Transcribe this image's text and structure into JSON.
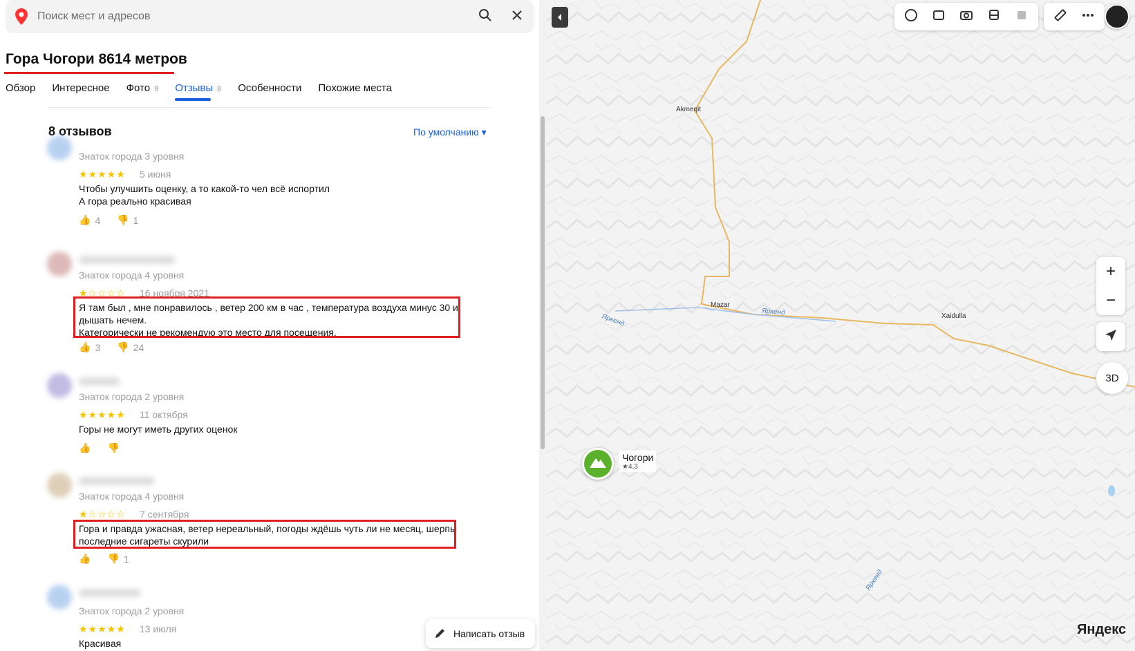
{
  "search": {
    "placeholder": "Поиск мест и адресов"
  },
  "place": {
    "title": "Гора Чогори 8614 метров"
  },
  "tabs": [
    {
      "label": "Обзор",
      "count": ""
    },
    {
      "label": "Интересное",
      "count": ""
    },
    {
      "label": "Фото",
      "count": "9"
    },
    {
      "label": "Отзывы",
      "count": "8"
    },
    {
      "label": "Особенности",
      "count": ""
    },
    {
      "label": "Похожие места",
      "count": ""
    }
  ],
  "reviews_header": {
    "title": "8 отзывов",
    "sort_label": "По умолчанию ▾"
  },
  "reviews": [
    {
      "level": "Знаток города 3 уровня",
      "stars": "★★★★★",
      "date": "5 июня",
      "text_line1": "Чтобы улучшить оценку, а то какой-то чел всё испортил",
      "text_line2": "А гора реально красивая",
      "likes": "4",
      "dislikes": "1"
    },
    {
      "level": "Знаток города 4 уровня",
      "stars": "★☆☆☆☆",
      "date": "16 ноября 2021",
      "text_line1": "Я там был , мне понравилось , ветер 200 км в час , температура воздуха минус 30 и",
      "text_line2": "дышать нечем.",
      "text_line3": "Категорически не рекомендую это место для посещения.",
      "likes": "3",
      "dislikes": "24"
    },
    {
      "level": "Знаток города 2 уровня",
      "stars": "★★★★★",
      "date": "11 октября",
      "text_line1": "Горы не могут иметь других оценок",
      "likes": "",
      "dislikes": ""
    },
    {
      "level": "Знаток города 4 уровня",
      "stars": "★☆☆☆☆",
      "date": "7 сентября",
      "text_line1": "Гора и правда ужасная, ветер нереальный, погоды ждёшь чуть ли не месяц, шерпы",
      "text_line2": "последние сигареты скурили",
      "likes": "",
      "dislikes": "1"
    },
    {
      "level": "Знаток города 2 уровня",
      "stars": "★★★★★",
      "date": "13 июля",
      "text_line1": "Красивая"
    }
  ],
  "write_review": {
    "label": "Написать отзыв"
  },
  "map": {
    "places": {
      "akmeqit": "Akmeqit",
      "mazar": "Mazar",
      "xaidulla": "Xaidulla"
    },
    "rivers": {
      "r1": "Яркенд",
      "r2": "Яркенд",
      "r3": "Яркенд"
    },
    "marker": {
      "name": "Чогори",
      "rating": "★4,3"
    },
    "zoom_in": "+",
    "zoom_out": "−",
    "btn_3d": "3D",
    "logo": "Яндекс"
  },
  "colors": {
    "accent": "#1a5ee0",
    "highlight": "#e02020",
    "star": "#f5c400",
    "marker": "#5bb12c"
  }
}
